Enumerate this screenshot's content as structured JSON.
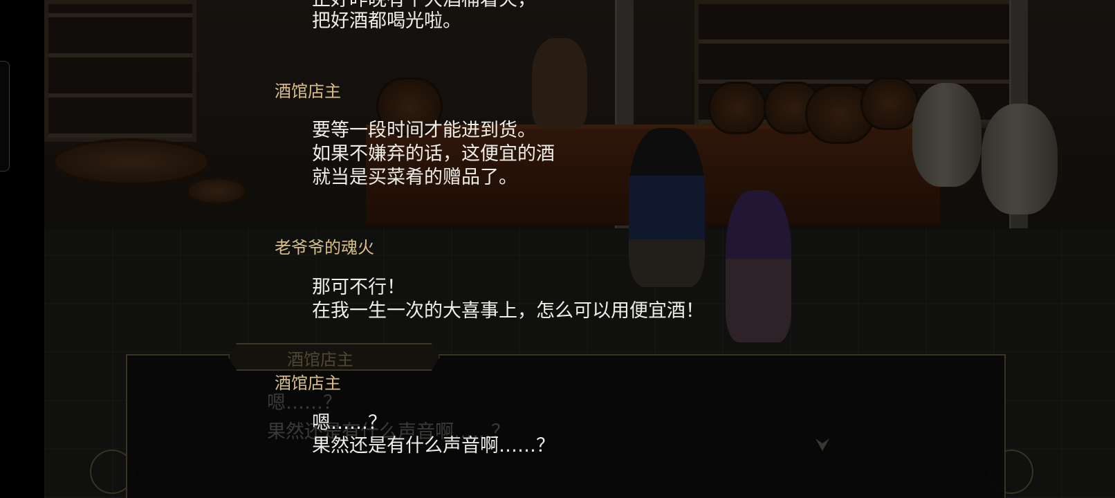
{
  "backlog": {
    "entries": [
      {
        "speaker": "",
        "lines": [
          "正好昨晚有个大酒桶着火，",
          "把好酒都喝光啦。"
        ]
      },
      {
        "speaker": "酒馆店主",
        "lines": [
          "要等一段时间才能进到货。",
          "如果不嫌弃的话，这便宜的酒",
          "就当是买菜肴的赠品了。"
        ]
      },
      {
        "speaker": "老爷爷的魂火",
        "lines": [
          "那可不行！",
          "在我一生一次的大喜事上，怎么可以用便宜酒！"
        ]
      },
      {
        "speaker": "酒馆店主",
        "lines": [
          "嗯……？",
          "果然还是有什么声音啊……？"
        ]
      }
    ]
  },
  "dialog": {
    "speaker": "酒馆店主",
    "text_line1": "嗯……？",
    "text_line2": "果然还是有什么声音啊……？",
    "advance_icon": "advance-arrow-icon"
  },
  "colors": {
    "speaker_name": "#d9bf86",
    "log_text": "#f0eee8",
    "dialog_box": "#0a0a0a"
  }
}
